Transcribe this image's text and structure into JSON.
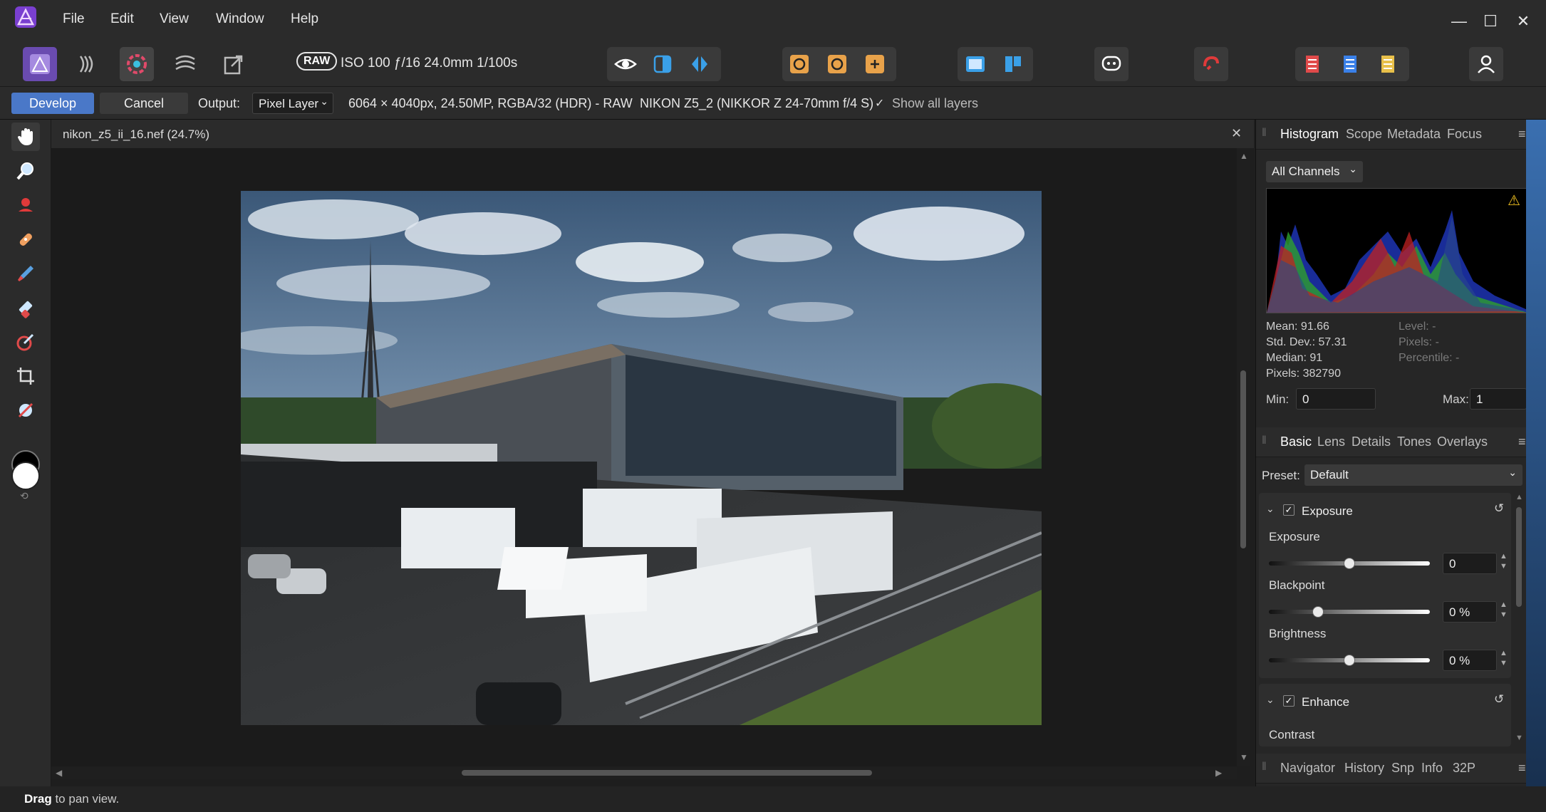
{
  "menubar": {
    "items": [
      "File",
      "Edit",
      "View",
      "Window",
      "Help"
    ],
    "window_controls": {
      "minimize": "—",
      "maximize": "☐",
      "close": "✕"
    }
  },
  "toolbar": {
    "raw_badge": "RAW",
    "exif": "ISO 100 ƒ/16 24.0mm 1/100s"
  },
  "contextbar": {
    "develop_label": "Develop",
    "cancel_label": "Cancel",
    "output_label": "Output:",
    "output_value": "Pixel Layer",
    "image_info": "6064 × 4040px, 24.50MP, RGBA/32 (HDR) - RAW",
    "camera_info": "NIKON Z5_2 (NIKKOR Z 24-70mm f/4 S)",
    "show_all_layers": "Show all layers",
    "show_all_layers_checked": true
  },
  "document": {
    "title": "nikon_z5_ii_16.nef (24.7%)",
    "close_label": "✕"
  },
  "histogram_panel": {
    "tabs": [
      "Histogram",
      "Scope",
      "Metadata",
      "Focus"
    ],
    "active_tab": "Histogram",
    "channel": "All Channels",
    "stats_left": [
      "Mean: 91.66",
      "Std. Dev.: 57.31",
      "Median: 91",
      "Pixels: 382790"
    ],
    "stats_right": [
      "Level: -",
      "Pixels: -",
      "Percentile: -"
    ],
    "min_label": "Min:",
    "min_value": "0",
    "max_label": "Max:",
    "max_value": "1",
    "warning_icon": "warning-triangle-icon"
  },
  "develop_panel": {
    "tabs": [
      "Basic",
      "Lens",
      "Details",
      "Tones",
      "Overlays"
    ],
    "active_tab": "Basic",
    "preset_label": "Preset:",
    "preset_value": "Default",
    "exposure_section": {
      "title": "Exposure",
      "checked": true,
      "sliders": [
        {
          "label": "Exposure",
          "value": "0",
          "position": 0.5
        },
        {
          "label": "Blackpoint",
          "value": "0 %",
          "position": 0.3
        },
        {
          "label": "Brightness",
          "value": "0 %",
          "position": 0.5
        }
      ]
    },
    "enhance_section": {
      "title": "Enhance",
      "checked": true,
      "first_label": "Contrast"
    }
  },
  "bottom_panel": {
    "tabs": [
      "Navigator",
      "History",
      "Snp",
      "Info",
      "32P"
    ]
  },
  "status": {
    "bold": "Drag",
    "text": " to pan view."
  }
}
